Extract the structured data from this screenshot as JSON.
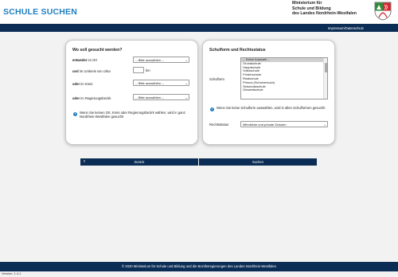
{
  "header": {
    "title": "SCHULE SUCHEN",
    "ministry_lines": [
      "Ministerium für",
      "Schule und Bildung",
      "des Landes Nordrhein-Westfalen"
    ],
    "nav_link": "Impressum/Datenschutz"
  },
  "left_card": {
    "title": "Wo soll gesucht werden?",
    "row_ort": {
      "prefix": "entweder",
      "label": " im Ort",
      "value": "-- Bitte auswählen --"
    },
    "row_umkreis": {
      "prefix": "und",
      "label": " im Umkreis von cirka",
      "unit": "km",
      "value": ""
    },
    "row_kreis": {
      "prefix": "oder",
      "label": " im Kreis",
      "value": "-- Bitte auswählen --"
    },
    "row_bezirk": {
      "prefix": "oder",
      "label": " im Regierungsbezirk",
      "value": "-- Bitte auswählen --"
    },
    "info": "Wenn Sie keinen Ort, Kreis oder Regierungsbezirk wählen, wird in ganz Nordrhein-Westfalen gesucht!"
  },
  "right_card": {
    "title": "Schulform und Rechtsstatus",
    "schulform_label": "Schulform",
    "schulform_options": [
      "-- Keine Auswahl --",
      "Grundschule",
      "Hauptschule",
      "Volksschule",
      "Förderschule",
      "Realschule",
      "Primus (Schulversuch)",
      "Sekundarschule",
      "Gesamtschule"
    ],
    "info": "Wenn Sie keine Schulform auswählen, wird in allen Schulformen gesucht!",
    "rechtsstatus_label": "Rechtsstatus",
    "rechtsstatus_value": "öffentliche und private Schulen"
  },
  "buttons": {
    "back": "Zurück",
    "search": "Suchen"
  },
  "footer": "© 2020 Ministerium für Schule und Bildung und die Bezirksregierungen des Landes Nordrhein-Westfalen",
  "version": "Version: 1.4.1"
}
